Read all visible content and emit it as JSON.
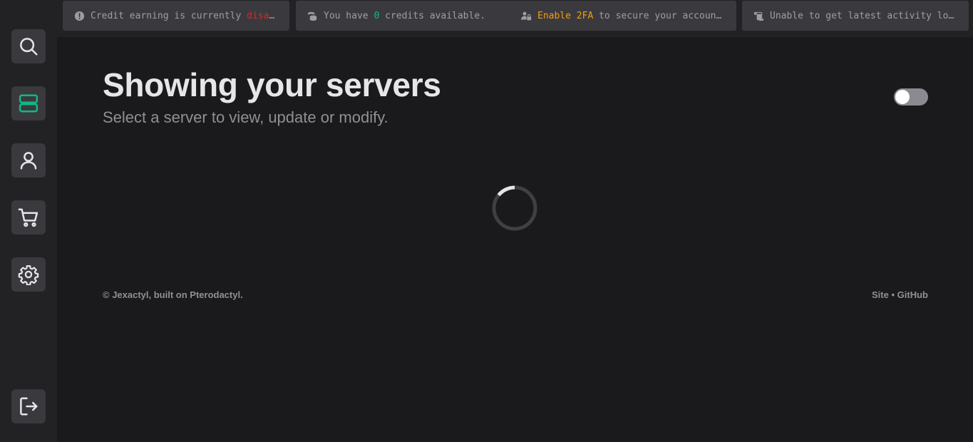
{
  "alerts": [
    {
      "prefix": "Credit earning is currently ",
      "highlight": "disabled",
      "suffix": "",
      "icon": "exclamation-circle-icon"
    },
    {
      "prefix": "You have ",
      "highlight": "0",
      "suffix": " credits available.",
      "icon": "coins-icon"
    },
    {
      "prefix": "",
      "highlight": "Enable 2FA",
      "suffix": " to secure your account.",
      "icon": "user-lock-icon"
    },
    {
      "prefix": "Unable to get latest activity logs.",
      "highlight": "",
      "suffix": "",
      "icon": "scroll-icon"
    }
  ],
  "sidebar": {
    "items": [
      {
        "name": "search",
        "icon": "search-icon"
      },
      {
        "name": "servers",
        "icon": "server-icon",
        "active": true
      },
      {
        "name": "account",
        "icon": "user-icon"
      },
      {
        "name": "store",
        "icon": "cart-icon"
      },
      {
        "name": "settings",
        "icon": "gear-icon"
      },
      {
        "name": "logout",
        "icon": "logout-icon"
      }
    ]
  },
  "main": {
    "title": "Showing your servers",
    "subtitle": "Select a server to view, update or modify.",
    "toggle_on": false,
    "loading": true
  },
  "footer": {
    "left": "© Jexactyl, built on Pterodactyl.",
    "site_link": "Site",
    "separator": "•",
    "github_link": "GitHub"
  },
  "colors": {
    "accent_green": "#10b981",
    "danger_red": "#e02424",
    "warning_orange": "#f59e0b",
    "background": "#1a1a1c",
    "sidebar": "#222224"
  }
}
